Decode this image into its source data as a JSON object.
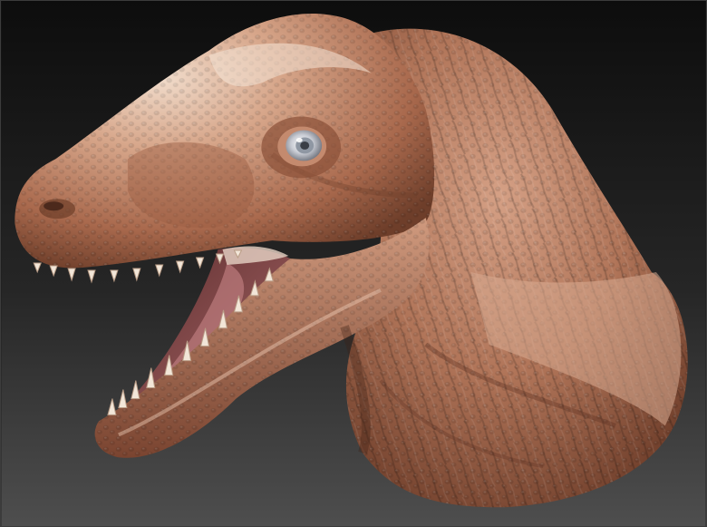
{
  "scene": {
    "subject": "dinosaur-head-sculpt",
    "colors": {
      "background_top": "#0d0d0d",
      "background_bottom": "#4e4e4e",
      "material_shadow": "#6e3e2a",
      "material_mid": "#b07458",
      "material_light": "#e9c3a8",
      "highlight": "#f4e4d6",
      "mouth_interior": "#8a4b4b",
      "tongue": "#a9686a",
      "teeth": "#f2e6d8",
      "eye_white": "#d7d9df",
      "eye_iris": "#8f97a3",
      "eye_pupil": "#3a3e46"
    },
    "icons": [
      "eye-icon",
      "tooth-icon"
    ]
  }
}
